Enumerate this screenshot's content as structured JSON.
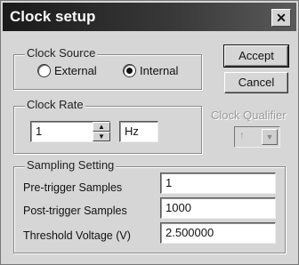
{
  "window": {
    "title": "Clock setup",
    "close_glyph": "✕"
  },
  "clock_source": {
    "label": "Clock Source",
    "options": [
      {
        "label": "External",
        "selected": false
      },
      {
        "label": "Internal",
        "selected": true
      }
    ]
  },
  "clock_rate": {
    "label": "Clock Rate",
    "value": "1",
    "unit": "Hz"
  },
  "clock_qualifier": {
    "label": "Clock Qualifier",
    "value": "↑"
  },
  "buttons": {
    "accept": "Accept",
    "cancel": "Cancel"
  },
  "sampling": {
    "label": "Sampling Setting",
    "rows": [
      {
        "label": "Pre-trigger Samples",
        "value": "1"
      },
      {
        "label": "Post-trigger Samples",
        "value": "1000"
      },
      {
        "label": "Threshold Voltage (V)",
        "value": "2.500000"
      }
    ]
  }
}
